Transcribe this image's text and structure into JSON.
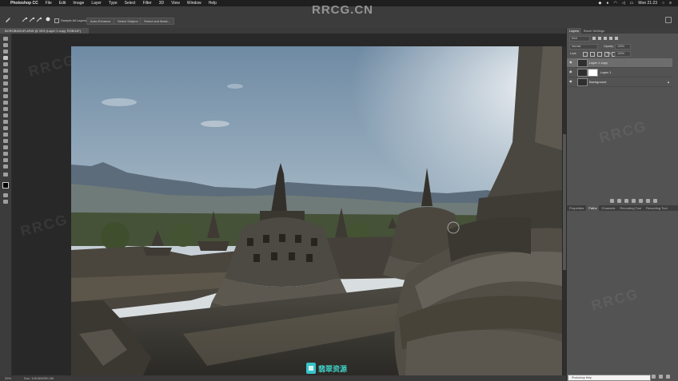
{
  "menubar": {
    "apple": "",
    "app_name": "Photoshop CC",
    "items": [
      "File",
      "Edit",
      "Image",
      "Layer",
      "Type",
      "Select",
      "Filter",
      "3D",
      "View",
      "Window",
      "Help"
    ],
    "clock": "Mon 21:23"
  },
  "watermark": "RRCG.CN",
  "options_bar": {
    "sample_all_layers": "Sample All Layers",
    "btn1": "Auto-Enhance",
    "btn2": "Select Subject",
    "btn3": "Select and Mask..."
  },
  "document": {
    "tab_title": "BOROBUDUR.ARW @ 33% (Layer 1 copy, RGB/16*)"
  },
  "statusbar": {
    "zoom": "33%",
    "doc_info": "Doc: 145.6M/290.2M"
  },
  "layers_panel": {
    "tabs": [
      "Layers",
      "Brush Settings"
    ],
    "kind_label": "Kind",
    "blend_mode": "Normal",
    "opacity_label": "Opacity:",
    "opacity_value": "100%",
    "lock_label": "Lock:",
    "fill_label": "Fill:",
    "fill_value": "100%",
    "layers": [
      {
        "name": "Layer 1 copy",
        "selected": true
      },
      {
        "name": "Layer 1",
        "selected": false
      },
      {
        "name": "Background",
        "selected": false
      }
    ]
  },
  "lower_panel": {
    "tabs": [
      "Properties",
      "Paths",
      "Channels",
      "Recording Tool",
      "Recording Tool"
    ]
  },
  "bottom_search": "Photoshop Help",
  "logo_text": "翡翠资源"
}
